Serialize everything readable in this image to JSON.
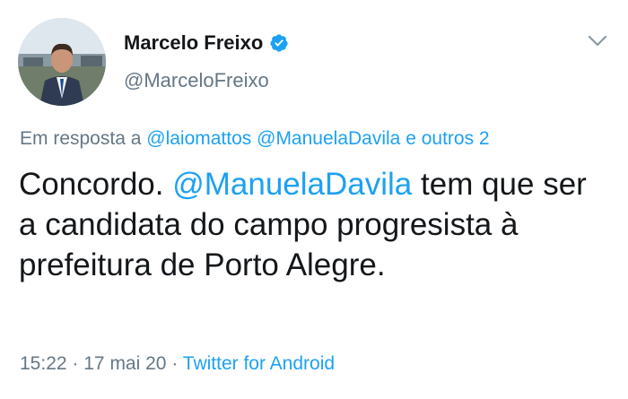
{
  "author": {
    "name": "Marcelo Freixo",
    "handle": "@MarceloFreixo",
    "verified_icon": "verified-badge-icon"
  },
  "menu_icon": "chevron-down-icon",
  "reply": {
    "prefix": "Em resposta a",
    "mention1": "@laiomattos",
    "mention2": "@ManuelaDavila",
    "conjunction": "e",
    "others": "outros 2"
  },
  "tweet": {
    "text_before": "Concordo.",
    "mention": "@ManuelaDavila",
    "text_after": "tem que ser a candidata do campo progresista à prefeitura de Porto Alegre."
  },
  "meta": {
    "time": "15:22",
    "date": "17 mai 20",
    "source": "Twitter for Android",
    "separator": "·"
  },
  "colors": {
    "link": "#1da1f2",
    "secondary_text": "#657786",
    "primary_text": "#14171a"
  }
}
